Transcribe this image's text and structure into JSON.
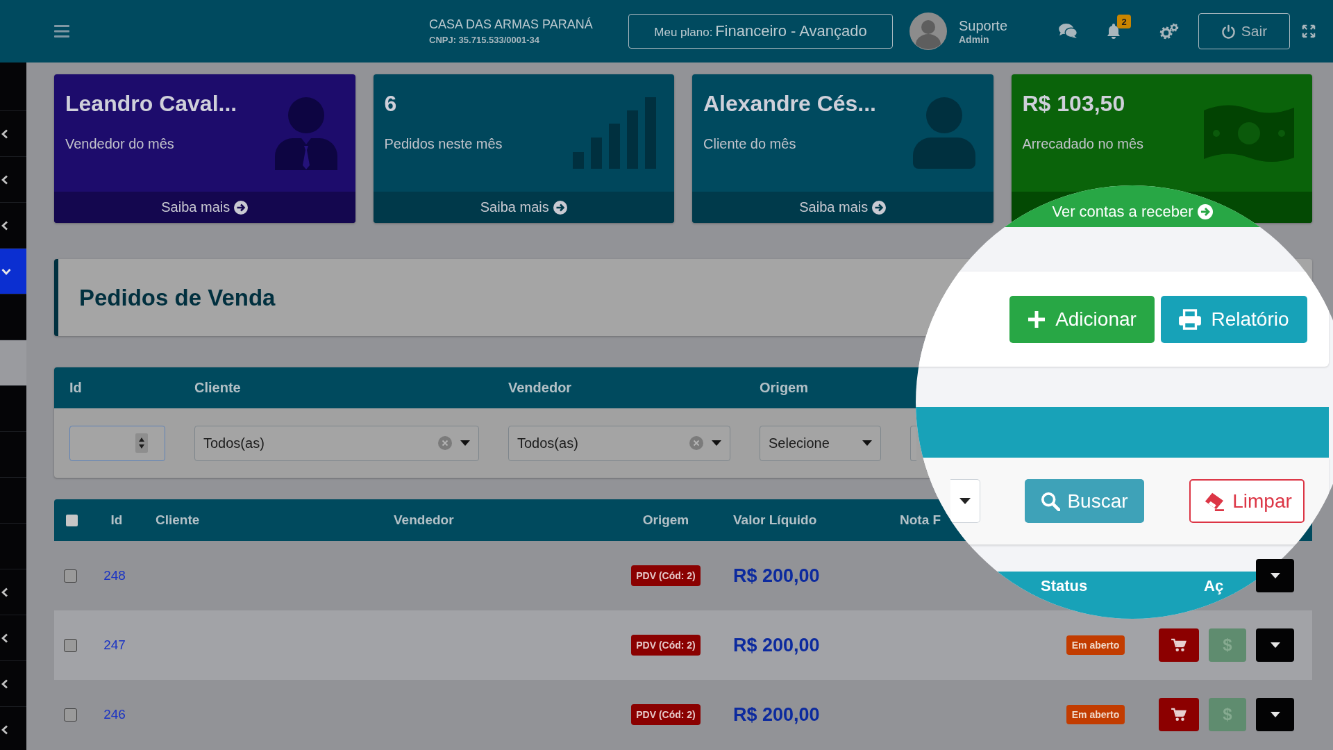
{
  "top_bar": {
    "company": "CASA DAS ARMAS PARANÁ",
    "cnpj": "CNPJ: 35.715.533/0001-34",
    "plan_label": "Meu plano:",
    "plan_value": "Financeiro - Avançado",
    "user_name": "Suporte",
    "user_role": "Admin",
    "notification_count": "2",
    "logout": "Sair"
  },
  "sidebar": {
    "items": [
      {
        "kind": "link",
        "selected": false,
        "highlighted": false
      },
      {
        "kind": "group",
        "expanded": false,
        "selected": false,
        "highlighted": false
      },
      {
        "kind": "group",
        "expanded": false,
        "selected": false,
        "highlighted": false
      },
      {
        "kind": "group",
        "expanded": false,
        "selected": false,
        "highlighted": false
      },
      {
        "kind": "group",
        "expanded": true,
        "selected": true,
        "highlighted": false
      },
      {
        "kind": "link",
        "selected": false,
        "highlighted": false
      },
      {
        "kind": "link",
        "selected": false,
        "highlighted": true
      },
      {
        "kind": "link",
        "selected": false,
        "highlighted": false
      },
      {
        "kind": "link",
        "selected": false,
        "highlighted": false
      },
      {
        "kind": "link",
        "selected": false,
        "highlighted": false
      },
      {
        "kind": "link",
        "selected": false,
        "highlighted": false
      },
      {
        "kind": "group",
        "expanded": false,
        "selected": false,
        "highlighted": false
      },
      {
        "kind": "group",
        "expanded": false,
        "selected": false,
        "highlighted": false
      },
      {
        "kind": "group",
        "expanded": false,
        "selected": false,
        "highlighted": false
      },
      {
        "kind": "group",
        "expanded": false,
        "selected": false,
        "highlighted": false
      }
    ]
  },
  "cards": [
    {
      "kind": "seller",
      "title": "Leandro Caval...",
      "subtitle": "Vendedor do mês",
      "link": "Saiba mais"
    },
    {
      "kind": "orders",
      "title": "6",
      "subtitle": "Pedidos neste mês",
      "link": "Saiba mais"
    },
    {
      "kind": "client",
      "title": "Alexandre Cés...",
      "subtitle": "Cliente do mês",
      "link": "Saiba mais"
    },
    {
      "kind": "revenue",
      "title": "R$ 103,50",
      "subtitle": "Arrecadado no mês"
    }
  ],
  "page_header": {
    "title": "Pedidos de Venda"
  },
  "filters": [
    {
      "kind": "number",
      "label": "Id"
    },
    {
      "kind": "select",
      "label": "Cliente",
      "value": "Todos(as)",
      "clearable": true
    },
    {
      "kind": "select",
      "label": "Vendedor",
      "value": "Todos(as)",
      "clearable": true
    },
    {
      "kind": "select",
      "label": "Origem",
      "value": "Selecione",
      "clearable": false
    },
    {
      "kind": "clipped"
    }
  ],
  "table": {
    "select_all": {
      "checked": false
    },
    "columns": [
      "Id",
      "Cliente",
      "Vendedor",
      "Origem",
      "Valor Líquido",
      "Nota F"
    ],
    "rows": [
      {
        "id": "248",
        "origin": "PDV (Cód: 2)",
        "value": "R$ 200,00",
        "checked": false,
        "actions": [
          {
            "kind": "menu",
            "disabled": false
          }
        ]
      },
      {
        "id": "247",
        "origin": "PDV (Cód: 2)",
        "value": "R$ 200,00",
        "status": "Em aberto",
        "checked": false,
        "actions": [
          {
            "kind": "cart",
            "disabled": false
          },
          {
            "kind": "payment",
            "label": "$",
            "disabled": true
          },
          {
            "kind": "menu",
            "disabled": false
          }
        ]
      },
      {
        "id": "246",
        "origin": "PDV (Cód: 2)",
        "value": "R$ 200,00",
        "status": "Em aberto",
        "checked": false,
        "actions": [
          {
            "kind": "cart",
            "disabled": false
          },
          {
            "kind": "payment",
            "label": "$",
            "disabled": true
          },
          {
            "kind": "menu",
            "disabled": false
          }
        ]
      }
    ]
  },
  "magnifier": {
    "card_link": "Ver contas a receber",
    "buttons": [
      {
        "kind": "add",
        "label": "Adicionar"
      },
      {
        "kind": "report",
        "label": "Relatório"
      }
    ],
    "filter_buttons": [
      {
        "kind": "search",
        "label": "Buscar"
      },
      {
        "kind": "clear",
        "label": "Limpar"
      }
    ],
    "table_columns": [
      "Status",
      "Aç"
    ]
  }
}
